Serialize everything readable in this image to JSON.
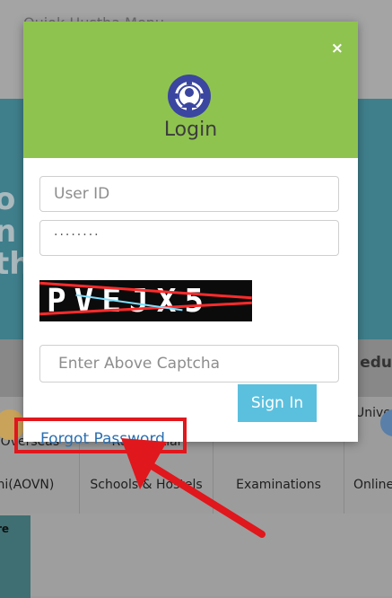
{
  "background": {
    "topbar_text": "Ouiok Hustha Menu",
    "banner_fragments": [
      "o",
      "n v",
      "th"
    ],
    "strip_text": "edu",
    "cards": [
      {
        "line1": "ar Overseas",
        "line2": "dhi(AOVN)"
      },
      {
        "line1": "Residential",
        "line2": "Schools & Hostels"
      },
      {
        "line1": "",
        "line2": "Examinations"
      },
      {
        "line1": "Univer",
        "line2": "Online"
      }
    ],
    "bottom_tile": "re"
  },
  "modal": {
    "close_symbol": "×",
    "title": "Login",
    "user_id_placeholder": "User ID",
    "password_value": "........",
    "captcha_text": "PVEJX5",
    "captcha_placeholder": "Enter Above Captcha",
    "signin_label": "Sign In",
    "forgot_label": "Forgot Password"
  },
  "colors": {
    "header": "#8fc34f",
    "signin": "#5bc0de",
    "link": "#2a6fb0",
    "annotation": "#e0171c"
  }
}
